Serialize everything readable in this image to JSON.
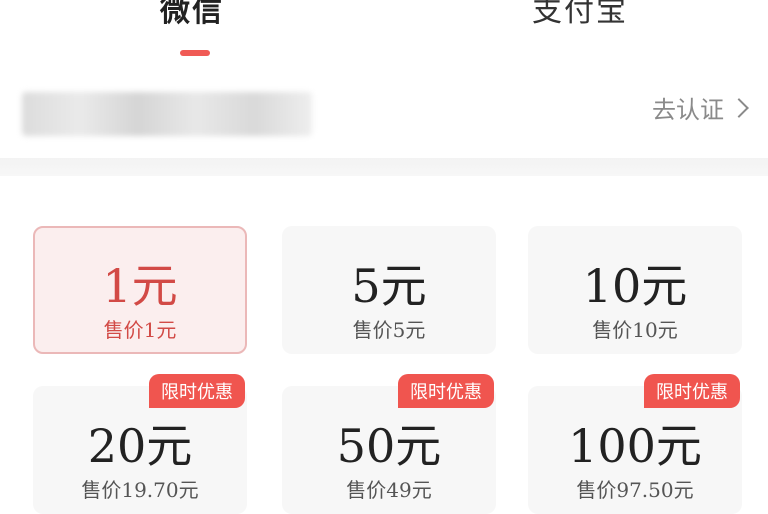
{
  "tabs": [
    {
      "label": "微信",
      "active": true
    },
    {
      "label": "支付宝",
      "active": false
    }
  ],
  "verify": {
    "link_label": "去认证"
  },
  "options": [
    {
      "amount": "1元",
      "price": "售价1元",
      "selected": true
    },
    {
      "amount": "5元",
      "price": "售价5元"
    },
    {
      "amount": "10元",
      "price": "售价10元"
    },
    {
      "amount": "20元",
      "price": "售价19.70元",
      "badge": "限时优惠"
    },
    {
      "amount": "50元",
      "price": "售价49元",
      "badge": "限时优惠"
    },
    {
      "amount": "100元",
      "price": "售价97.50元",
      "badge": "限时优惠"
    }
  ],
  "colors": {
    "accent": "#f05a55",
    "selected_bg": "#fbeeee",
    "selected_text": "#d24a46"
  }
}
